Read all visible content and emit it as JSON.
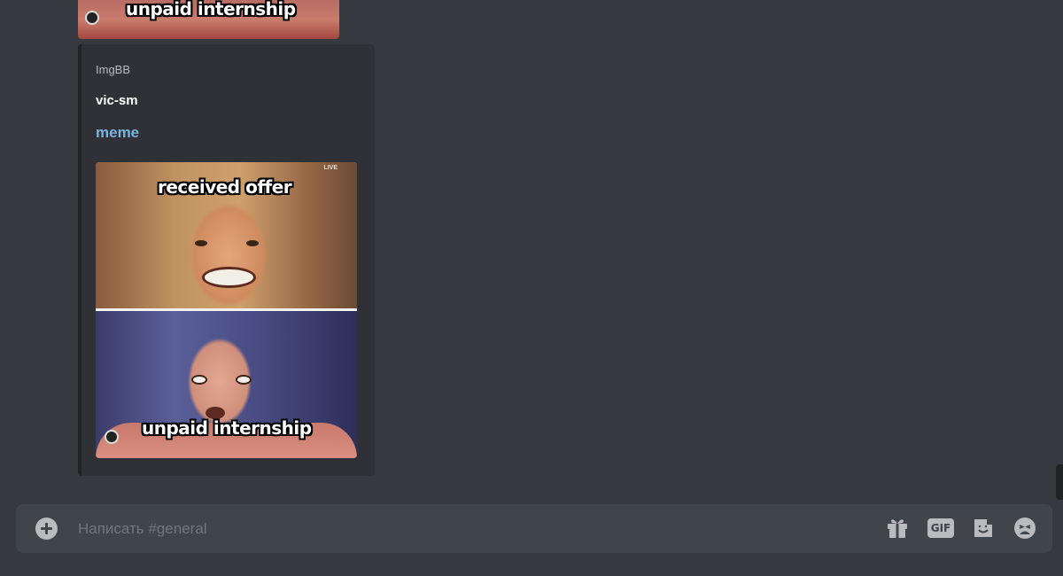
{
  "previous_message": {
    "image_caption": "unpaid internship"
  },
  "embed": {
    "provider": "ImgBB",
    "author": "vic-sm",
    "title": "meme",
    "image": {
      "top_caption": "received offer",
      "bottom_caption": "unpaid internship",
      "corner_tag": "LIVE"
    },
    "border_color": "#202225",
    "title_color": "#7ab5de"
  },
  "composer": {
    "placeholder": "Написать #general",
    "value": "",
    "icons": [
      "plus-circle-icon",
      "gift-icon",
      "gif-icon",
      "sticker-icon",
      "emoji-icon"
    ],
    "gif_label": "GIF"
  },
  "colors": {
    "background": "#36393f",
    "embed_bg": "#2f3136",
    "composer_bg": "#40444b",
    "icon": "#b9bbbe"
  }
}
